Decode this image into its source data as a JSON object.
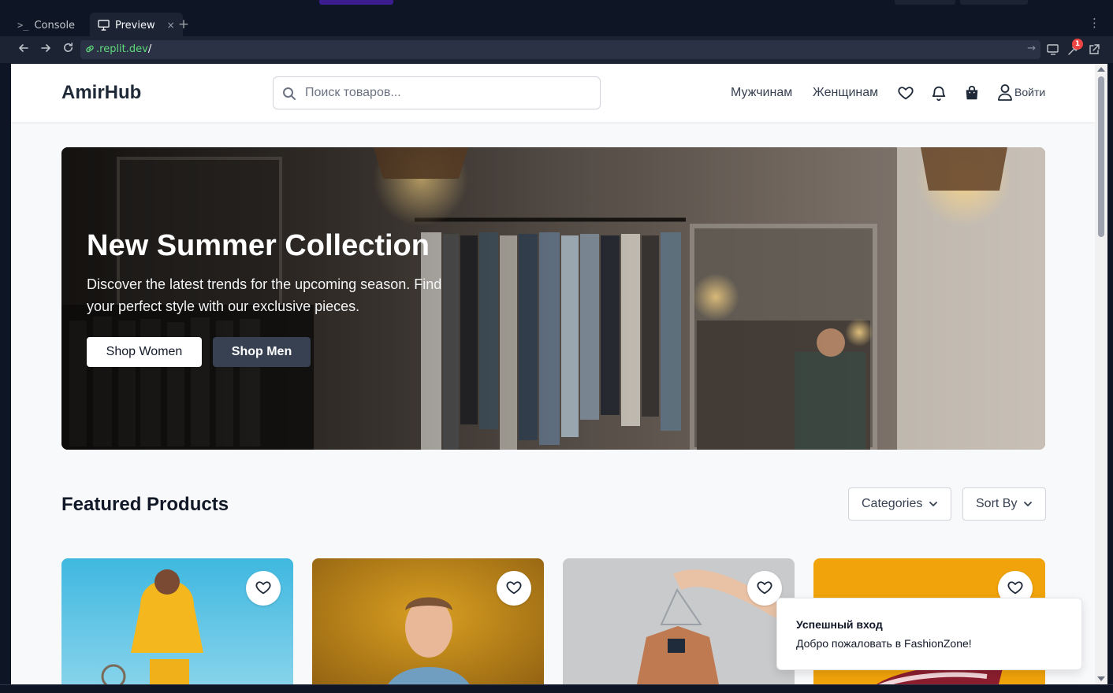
{
  "ide": {
    "tabs": [
      {
        "label": "Console",
        "icon": "terminal-icon",
        "active": false
      },
      {
        "label": "Preview",
        "icon": "monitor-icon",
        "active": true
      }
    ],
    "close_glyph": "×",
    "add_glyph": "+",
    "menu_glyph": "⋮",
    "url": {
      "host": ".replit.dev",
      "path": "/"
    },
    "notification_count": "1",
    "colors": {
      "chrome": "#0e1525",
      "panel": "#1c2333",
      "url_green": "#5fd97a"
    }
  },
  "site": {
    "logo": "AmirHub",
    "search": {
      "placeholder": "Поиск товаров...",
      "value": ""
    },
    "nav": {
      "men": "Мужчинам",
      "women": "Женщинам",
      "login": "Войти"
    },
    "hero": {
      "title": "New Summer Collection",
      "subtitle": "Discover the latest trends for the upcoming season. Find your perfect style with our exclusive pieces.",
      "shop_women": "Shop Women",
      "shop_men": "Shop Men"
    },
    "featured": {
      "title": "Featured Products",
      "categories_label": "Categories",
      "sort_label": "Sort By"
    },
    "toast": {
      "title": "Успешный вход",
      "message": "Добро пожаловать в FashionZone!"
    }
  }
}
